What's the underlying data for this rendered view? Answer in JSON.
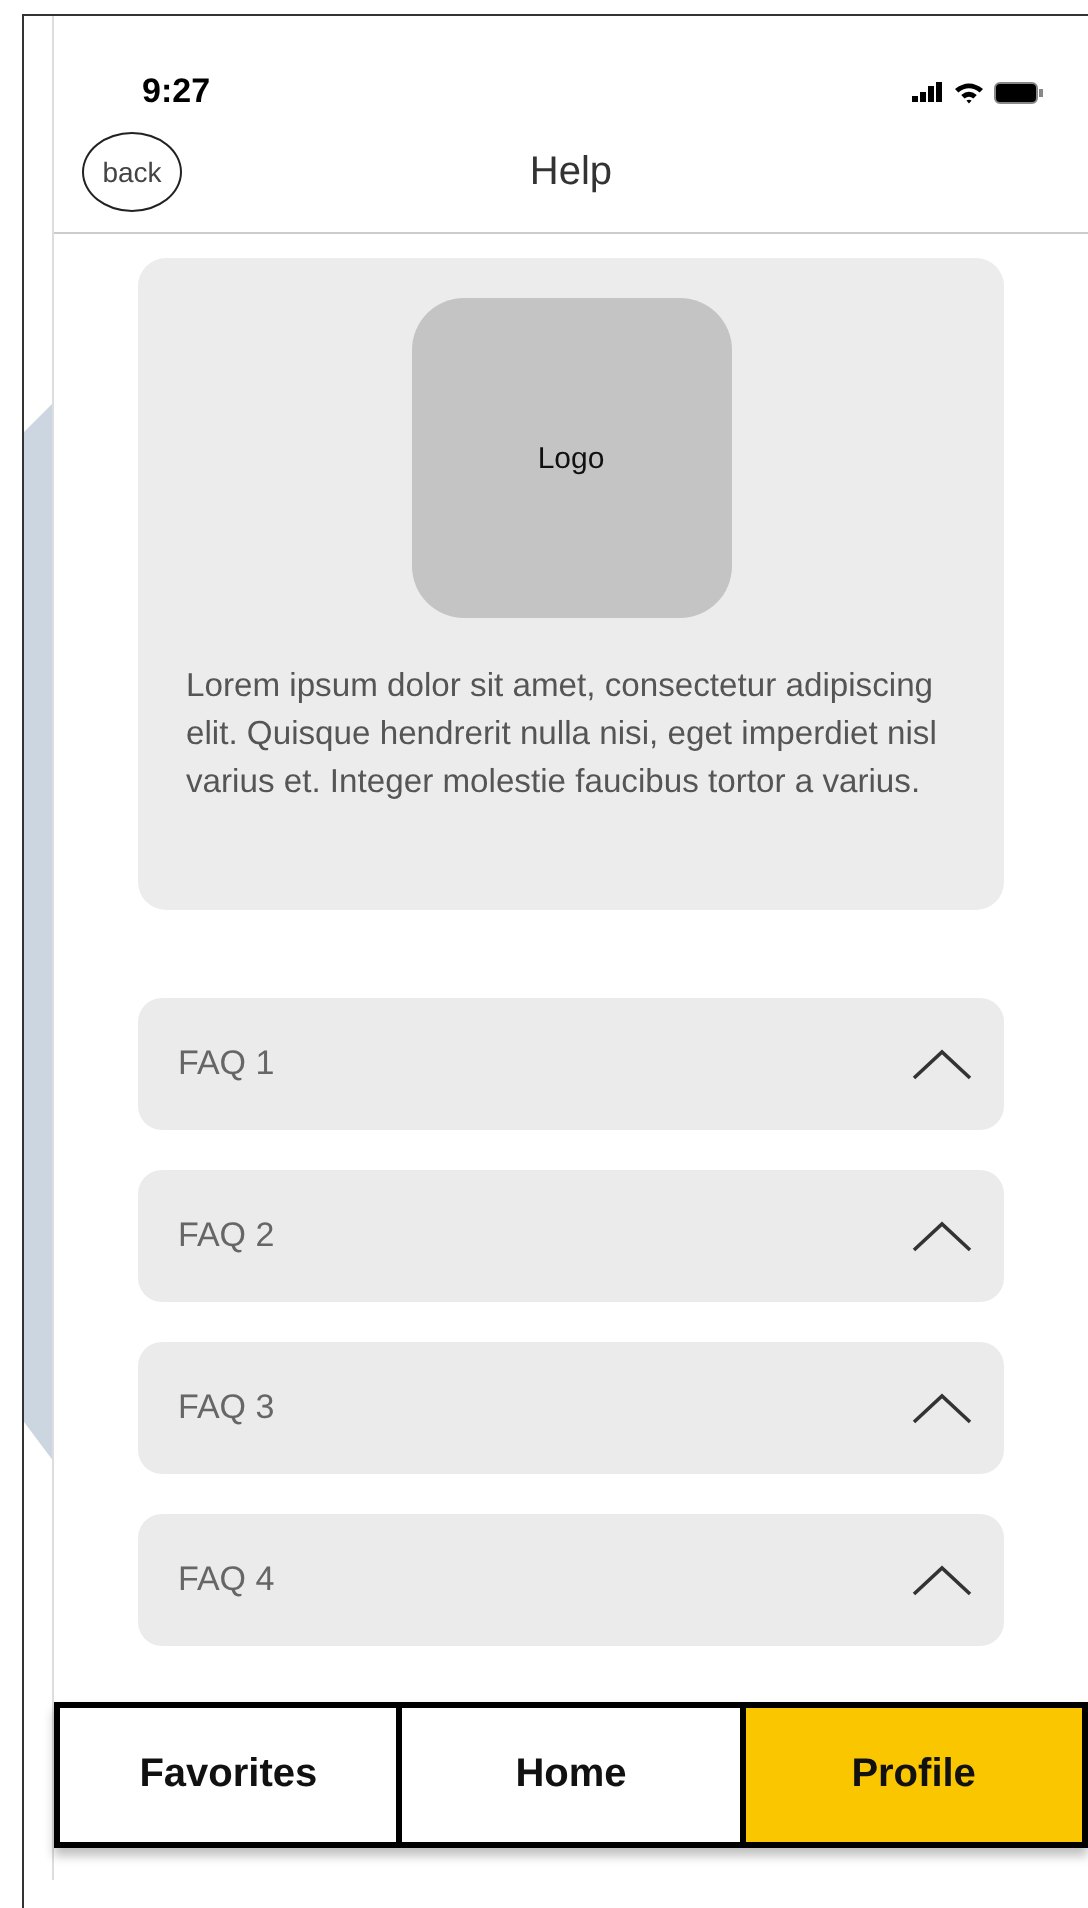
{
  "status_bar": {
    "time": "9:27"
  },
  "header": {
    "back_label": "back",
    "title": "Help"
  },
  "about": {
    "logo_label": "Logo",
    "text": "Lorem ipsum dolor sit amet, consectetur adipiscing elit. Quisque hendrerit nulla nisi, eget imperdiet nisl varius et. Integer molestie faucibus tortor a varius."
  },
  "faqs": [
    {
      "label": "FAQ 1"
    },
    {
      "label": "FAQ 2"
    },
    {
      "label": "FAQ 3"
    },
    {
      "label": "FAQ 4"
    }
  ],
  "tabs": [
    {
      "label": "Favorites",
      "selected": false
    },
    {
      "label": "Home",
      "selected": false
    },
    {
      "label": "Profile",
      "selected": true
    }
  ]
}
